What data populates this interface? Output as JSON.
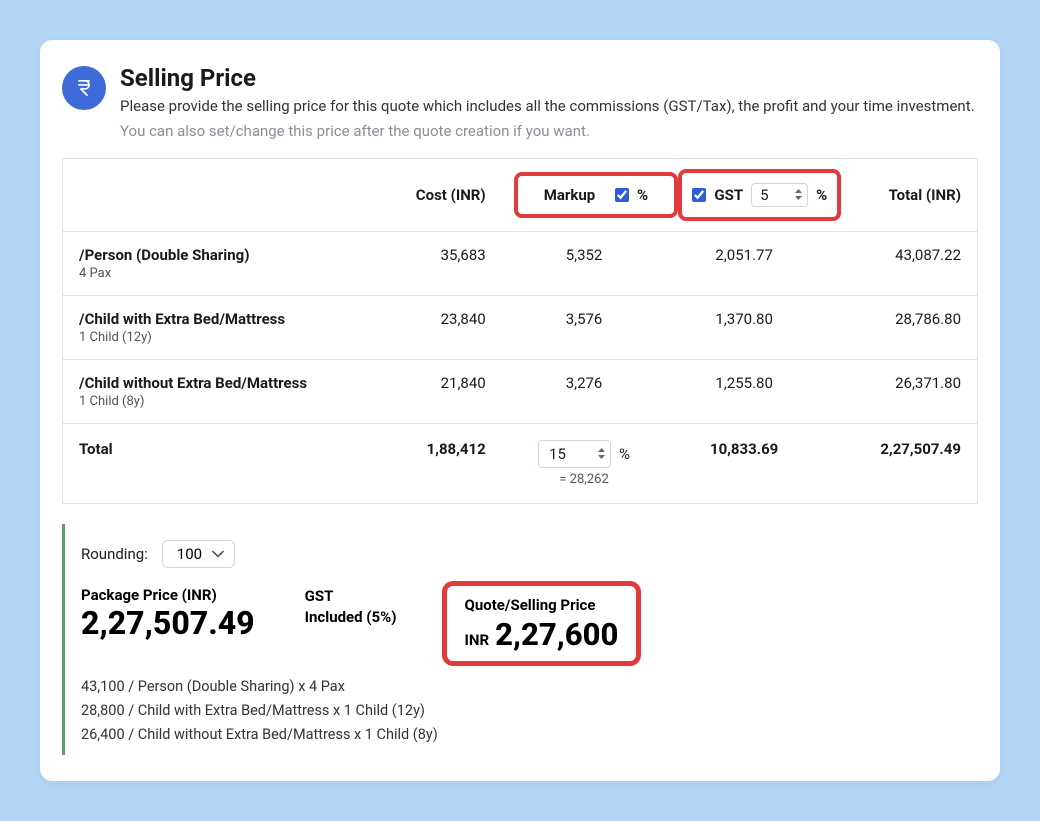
{
  "header": {
    "title": "Selling Price",
    "desc": "Please provide the selling price for this quote which includes all the commissions (GST/Tax), the profit and your time investment.",
    "hint": "You can also set/change this price after the quote creation if you want."
  },
  "columns": {
    "cost": "Cost (INR)",
    "markup": "Markup",
    "gst": "GST",
    "total": "Total (INR)",
    "pct": "%"
  },
  "gst_input": "5",
  "rows": [
    {
      "label": "/Person (Double Sharing)",
      "sub": "4 Pax",
      "cost": "35,683",
      "markup": "5,352",
      "gst": "2,051.77",
      "total": "43,087.22"
    },
    {
      "label": "/Child with Extra Bed/Mattress",
      "sub": "1 Child (12y)",
      "cost": "23,840",
      "markup": "3,576",
      "gst": "1,370.80",
      "total": "28,786.80"
    },
    {
      "label": "/Child without Extra Bed/Mattress",
      "sub": "1 Child (8y)",
      "cost": "21,840",
      "markup": "3,276",
      "gst": "1,255.80",
      "total": "26,371.80"
    }
  ],
  "totals": {
    "label": "Total",
    "cost": "1,88,412",
    "markup_input": "15",
    "markup_eq": "= 28,262",
    "gst": "10,833.69",
    "total": "2,27,507.49"
  },
  "summary": {
    "rounding_label": "Rounding:",
    "rounding_value": "100",
    "package_label": "Package Price (INR)",
    "package_value": "2,27,507.49",
    "gst_label": "GST",
    "gst_value": "Included (5%)",
    "quote_label": "Quote/Selling Price",
    "quote_currency": "INR",
    "quote_value": "2,27,600",
    "lines": [
      "43,100  / Person (Double Sharing) x 4 Pax",
      "28,800  / Child with Extra Bed/Mattress x 1 Child (12y)",
      "26,400  / Child without Extra Bed/Mattress x 1 Child (8y)"
    ]
  }
}
